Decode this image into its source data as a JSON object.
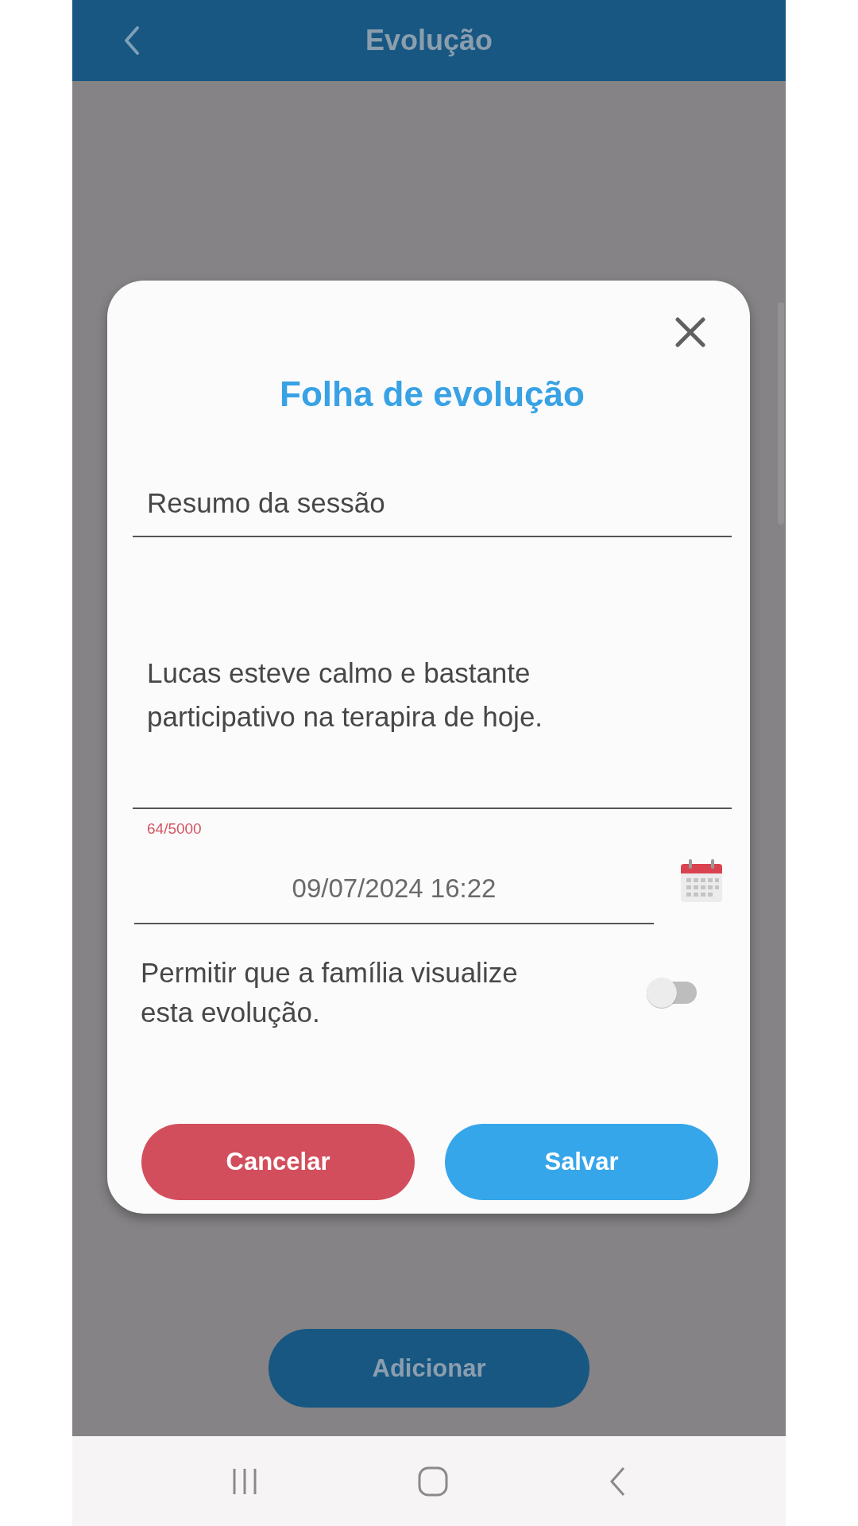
{
  "app_bar": {
    "title": "Evolução"
  },
  "dialog": {
    "title": "Folha de evolução",
    "summary_field": {
      "placeholder": "Resumo da sessão"
    },
    "notes_field": {
      "value": "Lucas esteve calmo e bastante participativo na terapira de hoje.",
      "counter": "64/5000"
    },
    "date_field": {
      "value": "09/07/2024 16:22"
    },
    "family_toggle": {
      "label": "Permitir que a família visualize esta evolução.",
      "on": false
    },
    "buttons": [
      {
        "label": "Cancelar",
        "kind": "cancel"
      },
      {
        "label": "Salvar",
        "kind": "save"
      }
    ]
  },
  "add_button": {
    "label": "Adicionar"
  }
}
